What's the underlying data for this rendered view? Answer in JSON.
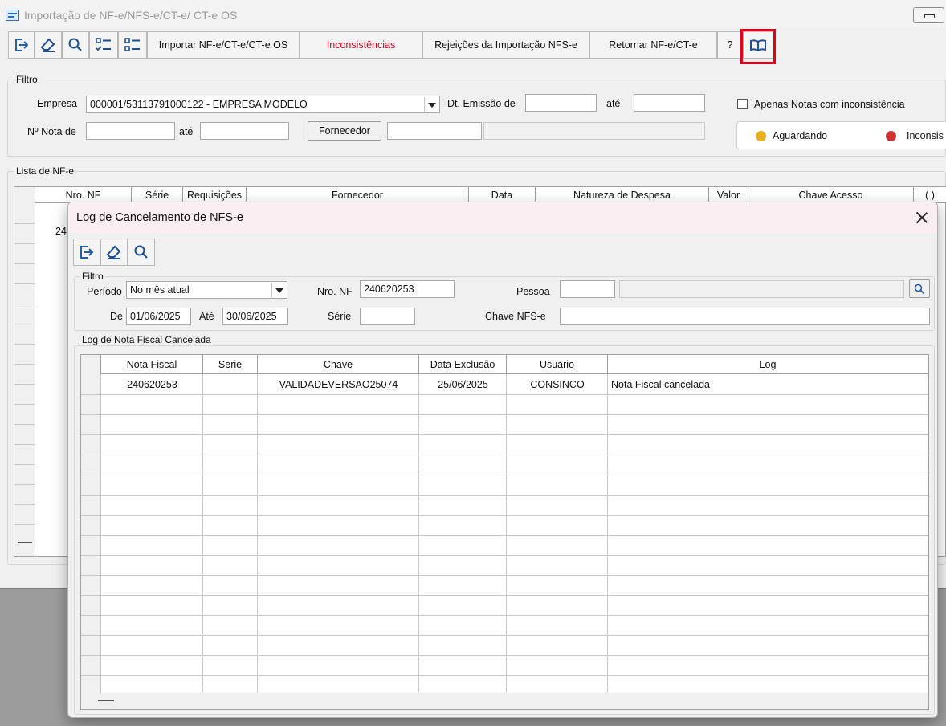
{
  "main": {
    "title": "Importação de NF-e/NFS-e/CT-e/ CT-e OS",
    "toolbar": {
      "import_label": "Importar NF-e/CT-e/CT-e OS",
      "inconsistencias_label": "Inconsistências",
      "rejeicoes_label": "Rejeições da Importação NFS-e",
      "retornar_label": "Retornar NF-e/CT-e",
      "help_label": "?"
    },
    "filtro": {
      "title": "Filtro",
      "empresa_label": "Empresa",
      "empresa_value": "000001/53113791000122 - EMPRESA MODELO",
      "dt_emissao_label": "Dt. Emissão de",
      "dt_emissao_de": "",
      "ate1_label": "até",
      "dt_emissao_ate": "",
      "apenas_label": "Apenas Notas com inconsistência",
      "nota_de_label": "Nº Nota de",
      "nota_de_value": "",
      "ate2_label": "até",
      "nota_ate_value": "",
      "fornecedor_button": "Fornecedor",
      "fornecedor_code": "",
      "fornecedor_name": ""
    },
    "legend": {
      "aguardando_label": "Aguardando",
      "aguardando_color": "#e8b020",
      "inconsist_label": "Inconsis",
      "inconsist_color": "#cc3333"
    },
    "lista": {
      "title": "Lista de NF-e",
      "columns": [
        "Nro. NF",
        "Série",
        "Requisições",
        "Fornecedor",
        "Data",
        "Natureza de Despesa",
        "Valor",
        "Chave Acesso",
        "( )"
      ],
      "first_row_fragment": "24"
    }
  },
  "dialog": {
    "title": "Log de Cancelamento de NFS-e",
    "filtro": {
      "title": "Filtro",
      "periodo_label": "Período",
      "periodo_value": "No mês atual",
      "nro_nf_label": "Nro. NF",
      "nro_nf_value": "240620253",
      "pessoa_label": "Pessoa",
      "pessoa_code": "",
      "pessoa_name": "",
      "de_label": "De",
      "de_value": "01/06/2025",
      "ate_label": "Até",
      "ate_value": "30/06/2025",
      "serie_label": "Série",
      "serie_value": "",
      "chave_label": "Chave NFS-e",
      "chave_value": ""
    },
    "log": {
      "title": "Log de Nota Fiscal Cancelada",
      "columns": [
        "Nota Fiscal",
        "Serie",
        "Chave",
        "Data Exclusão",
        "Usuário",
        "Log"
      ],
      "rows": [
        [
          "240620253",
          "",
          "VALIDADEVERSAO25074",
          "25/06/2025",
          "CONSINCO",
          "Nota Fiscal cancelada"
        ]
      ]
    }
  }
}
